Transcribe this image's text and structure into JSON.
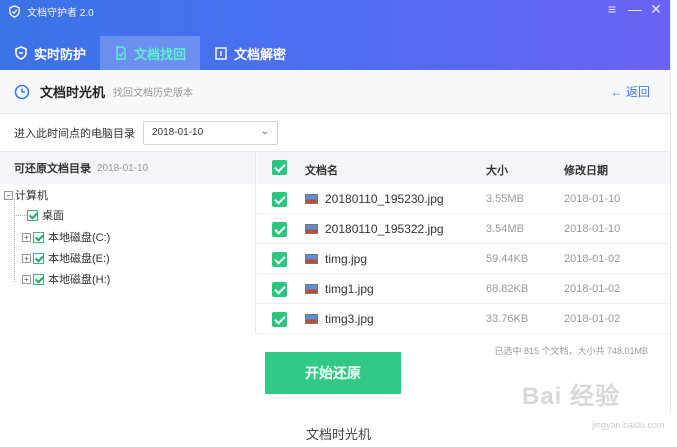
{
  "app": {
    "title": "文档守护者 2.0",
    "window_controls": [
      "≡",
      "—",
      "✕"
    ]
  },
  "tabs": [
    {
      "label": "实时防护",
      "active": false,
      "icon": "shield-icon"
    },
    {
      "label": "文档找回",
      "active": true,
      "icon": "restore-doc-icon"
    },
    {
      "label": "文档解密",
      "active": false,
      "icon": "unlock-doc-icon"
    }
  ],
  "section": {
    "title": "文档时光机",
    "subtitle": "找回文档历史版本",
    "back_label": "返回",
    "back_arrow": "←"
  },
  "date_filter": {
    "label": "进入此时间点的电脑目录",
    "value": "2018-01-10"
  },
  "tree": {
    "header": "可还原文档目录",
    "header_date": "2018-01-10",
    "root": "计算机",
    "items": [
      "桌面",
      "本地磁盘(C:)",
      "本地磁盘(E:)",
      "本地磁盘(H:)"
    ]
  },
  "table": {
    "columns": [
      "文档名",
      "大小",
      "修改日期"
    ],
    "rows": [
      {
        "name": "20180110_195230.jpg",
        "size": "3.55MB",
        "date": "2018-01-10"
      },
      {
        "name": "20180110_195322.jpg",
        "size": "3.54MB",
        "date": "2018-01-10"
      },
      {
        "name": "timg.jpg",
        "size": "59.44KB",
        "date": "2018-01-02"
      },
      {
        "name": "timg1.jpg",
        "size": "68.82KB",
        "date": "2018-01-02"
      },
      {
        "name": "timg3.jpg",
        "size": "33.76KB",
        "date": "2018-01-02"
      }
    ]
  },
  "summary": "已选中 815 个文档，大小共 748.01MB",
  "start_button": "开始还原",
  "caption": "文档时光机",
  "watermark": "Bai 经验",
  "watermark_sub": "jingyan.baidu.com",
  "colors": {
    "header_start": "#3b73e6",
    "header_end": "#6a62f5",
    "active_tab_text": "#5ff0d4",
    "accent_green": "#2fcb86",
    "link_blue": "#3b7be8"
  }
}
